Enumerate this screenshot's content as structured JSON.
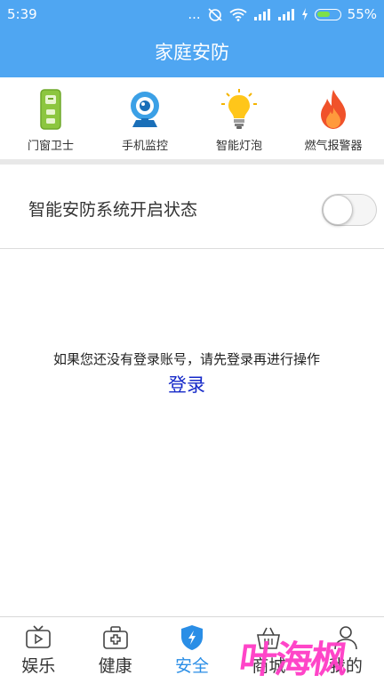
{
  "status_bar": {
    "time": "5:39",
    "dots": "...",
    "battery": "55%"
  },
  "header": {
    "title": "家庭安防"
  },
  "features": [
    {
      "label": "门窗卫士",
      "icon": "door-window-sensor-icon"
    },
    {
      "label": "手机监控",
      "icon": "camera-icon"
    },
    {
      "label": "智能灯泡",
      "icon": "lightbulb-icon"
    },
    {
      "label": "燃气报警器",
      "icon": "flame-icon"
    }
  ],
  "security": {
    "label": "智能安防系统开启状态",
    "enabled": false
  },
  "notice": {
    "text": "如果您还没有登录账号，请先登录再进行操作",
    "login_label": "登录"
  },
  "tabs": [
    {
      "label": "娱乐",
      "icon": "tv-icon"
    },
    {
      "label": "健康",
      "icon": "medical-kit-icon"
    },
    {
      "label": "安全",
      "icon": "shield-icon",
      "active": true
    },
    {
      "label": "商城",
      "icon": "shopping-basket-icon"
    },
    {
      "label": "我的",
      "icon": "user-icon"
    }
  ],
  "watermark": "叶海枫",
  "colors": {
    "primary": "#4fa6f2",
    "active_tab": "#2a8ee6",
    "link": "#1428c8",
    "watermark": "#ff3cc6"
  }
}
